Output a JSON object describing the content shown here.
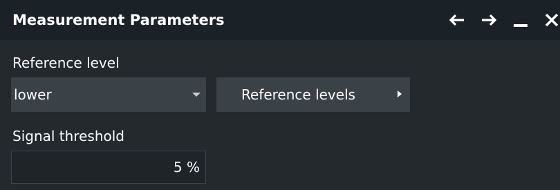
{
  "dialog": {
    "title": "Measurement Parameters",
    "icons": {
      "back": "arrow-left-icon",
      "forward": "arrow-right-icon",
      "minimize": "minimize-icon",
      "close": "close-icon"
    }
  },
  "reference_level": {
    "label": "Reference level",
    "selected": "lower"
  },
  "reference_levels_button": {
    "label": "Reference levels"
  },
  "signal_threshold": {
    "label": "Signal threshold",
    "value": "5 %"
  },
  "colors": {
    "background": "#24292e",
    "titlebar": "#1b2227",
    "control": "#3a4147",
    "text": "#ffffff"
  }
}
